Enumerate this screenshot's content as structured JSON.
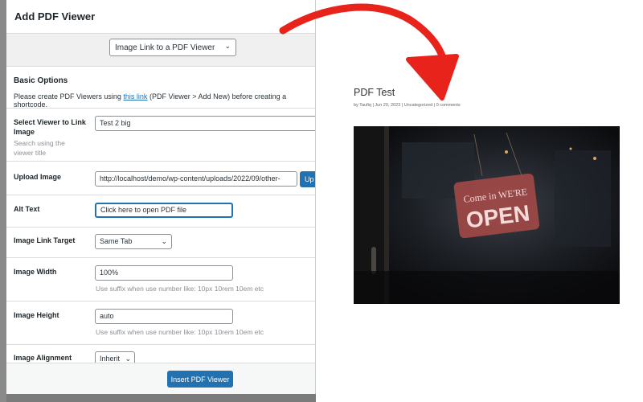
{
  "modal": {
    "title": "Add PDF Viewer",
    "mode_select": "Image Link to a PDF Viewer",
    "section_title": "Basic Options",
    "note_before": "Please create PDF Viewers using",
    "note_link": "this link",
    "note_after": "(PDF Viewer > Add New) before creating a shortcode.",
    "fields": {
      "viewer_label": "Select Viewer to Link Image",
      "viewer_desc": "Search using the viewer title",
      "viewer_value": "Test 2 big",
      "upload_label": "Upload Image",
      "upload_value": "http://localhost/demo/wp-content/uploads/2022/09/other-",
      "upload_button": "Up",
      "alt_label": "Alt Text",
      "alt_value": "Click here to open PDF file",
      "target_label": "Image Link Target",
      "target_value": "Same Tab",
      "width_label": "Image Width",
      "width_value": "100%",
      "width_desc": "Use suffix when use number like: 10px 10rem 10em etc",
      "height_label": "Image Height",
      "height_value": "auto",
      "height_desc": "Use suffix when use number like: 10px 10rem 10em etc",
      "align_label": "Image Alignment",
      "align_value": "Inherit"
    },
    "insert_button": "Insert PDF Viewer"
  },
  "post": {
    "title": "PDF Test",
    "meta": "by Taufiq | Jun 20, 2023 | Uncategorized | 0 comments",
    "sign_text_small": "Come in WE'RE",
    "sign_text_big": "OPEN"
  },
  "colors": {
    "accent": "#2271b1",
    "arrow": "#e8231c",
    "frame": "#7b7b7b"
  }
}
